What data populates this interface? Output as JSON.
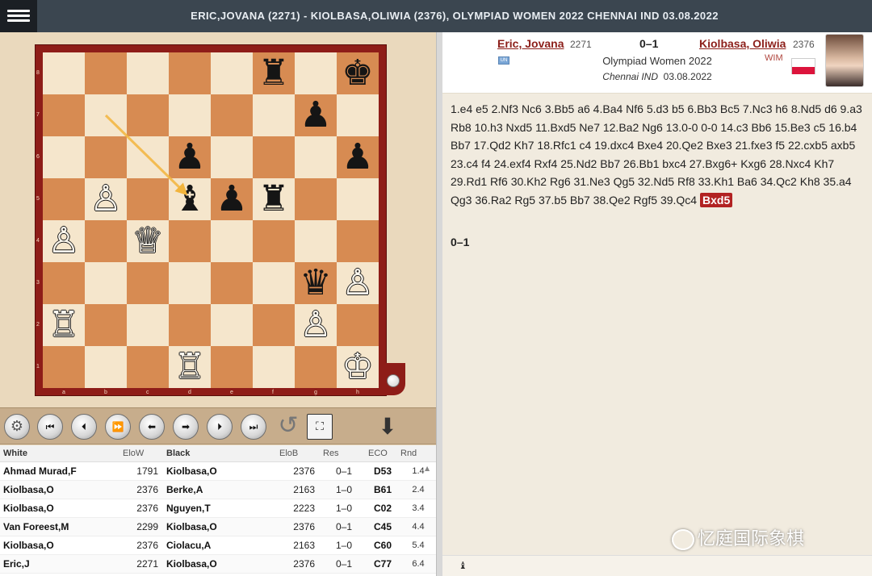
{
  "title": "ERIC,JOVANA (2271) - KIOLBASA,OLIWIA (2376), OLYMPIAD WOMEN 2022 CHENNAI IND 03.08.2022",
  "board": {
    "ranks": [
      "8",
      "7",
      "6",
      "5",
      "4",
      "3",
      "2",
      "1"
    ],
    "files": [
      "a",
      "b",
      "c",
      "d",
      "e",
      "f",
      "g",
      "h"
    ],
    "pieces": [
      {
        "square": "f8",
        "color": "b",
        "type": "rook",
        "glyph": "♜"
      },
      {
        "square": "h8",
        "color": "b",
        "type": "king",
        "glyph": "♚"
      },
      {
        "square": "g7",
        "color": "b",
        "type": "pawn",
        "glyph": "♟"
      },
      {
        "square": "d6",
        "color": "b",
        "type": "pawn",
        "glyph": "♟"
      },
      {
        "square": "h6",
        "color": "b",
        "type": "pawn",
        "glyph": "♟"
      },
      {
        "square": "b5",
        "color": "w",
        "type": "pawn",
        "glyph": "♙"
      },
      {
        "square": "d5",
        "color": "b",
        "type": "bishop",
        "glyph": "♝"
      },
      {
        "square": "e5",
        "color": "b",
        "type": "pawn",
        "glyph": "♟"
      },
      {
        "square": "f5",
        "color": "b",
        "type": "rook",
        "glyph": "♜"
      },
      {
        "square": "a4",
        "color": "w",
        "type": "pawn",
        "glyph": "♙"
      },
      {
        "square": "c4",
        "color": "w",
        "type": "queen",
        "glyph": "♕"
      },
      {
        "square": "g3",
        "color": "b",
        "type": "queen",
        "glyph": "♛"
      },
      {
        "square": "h3",
        "color": "w",
        "type": "pawn",
        "glyph": "♙"
      },
      {
        "square": "a2",
        "color": "w",
        "type": "rook",
        "glyph": "♖"
      },
      {
        "square": "g2",
        "color": "w",
        "type": "pawn",
        "glyph": "♙"
      },
      {
        "square": "d1",
        "color": "w",
        "type": "rook",
        "glyph": "♖"
      },
      {
        "square": "h1",
        "color": "w",
        "type": "king",
        "glyph": "♔"
      }
    ],
    "last_move_arrow": {
      "from": "b7",
      "to": "d5",
      "color": "#f2b43c"
    }
  },
  "toolbar": {
    "settings_icon": "⚙",
    "first_icon": "⏮",
    "prev_icon": "⏴",
    "play_icon": "⏩",
    "back_icon": "⬅",
    "forward_icon": "➡",
    "next_icon": "⏵",
    "last_icon": "⏭",
    "flip_icon": "↺",
    "fullscreen_icon": "⛶",
    "download_icon": "⬇"
  },
  "games_table": {
    "headers": [
      "White",
      "EloW",
      "Black",
      "EloB",
      "Res",
      "ECO",
      "Rnd"
    ],
    "rows": [
      [
        "Ahmad Murad,F",
        "1791",
        "Kiolbasa,O",
        "2376",
        "0–1",
        "D53",
        "1.4"
      ],
      [
        "Kiolbasa,O",
        "2376",
        "Berke,A",
        "2163",
        "1–0",
        "B61",
        "2.4"
      ],
      [
        "Kiolbasa,O",
        "2376",
        "Nguyen,T",
        "2223",
        "1–0",
        "C02",
        "3.4"
      ],
      [
        "Van Foreest,M",
        "2299",
        "Kiolbasa,O",
        "2376",
        "0–1",
        "C45",
        "4.4"
      ],
      [
        "Kiolbasa,O",
        "2376",
        "Ciolacu,A",
        "2163",
        "1–0",
        "C60",
        "5.4"
      ],
      [
        "Eric,J",
        "2271",
        "Kiolbasa,O",
        "2376",
        "0–1",
        "C77",
        "6.4"
      ]
    ],
    "scroll_up_icon": "▲"
  },
  "header": {
    "white_name": "Eric, Jovana",
    "white_elo": "2271",
    "white_flag": "UN",
    "result": "0–1",
    "event": "Olympiad Women 2022",
    "site": "Chennai IND",
    "date": "03.08.2022",
    "black_name": "Kiolbasa, Oliwia",
    "black_elo": "2376",
    "black_title": "WIM",
    "black_flag_colors": [
      "#ffffff",
      "#dc143c"
    ]
  },
  "moves": {
    "text": "1.e4 e5 2.Nf3 Nc6 3.Bb5 a6 4.Ba4 Nf6 5.d3 b5 6.Bb3 Bc5 7.Nc3 h6 8.Nd5 d6 9.a3 Rb8 10.h3 Nxd5 11.Bxd5 Ne7 12.Ba2 Ng6 13.0-0 0-0 14.c3 Bb6 15.Be3 c5 16.b4 Bb7 17.Qd2 Kh7 18.Rfc1 c4 19.dxc4 Bxe4 20.Qe2 Bxe3 21.fxe3 f5 22.cxb5 axb5 23.c4 f4 24.exf4 Rxf4 25.Nd2 Bb7 26.Bb1 bxc4 27.Bxg6+ Kxg6 28.Nxc4 Kh7 29.Rd1 Rf6 30.Kh2 Rg6 31.Ne3 Qg5 32.Nd5 Rf8 33.Kh1 Ba6 34.Qc2 Kh8 35.a4 Qg3 36.Ra2 Rg5 37.b5 Bb7 38.Qe2 Rgf5 39.Qc4",
    "current_move": "Bxd5",
    "final_result": "0–1"
  },
  "footer": {
    "icon": "♝"
  },
  "watermark": {
    "text": "忆庭国际象棋"
  }
}
